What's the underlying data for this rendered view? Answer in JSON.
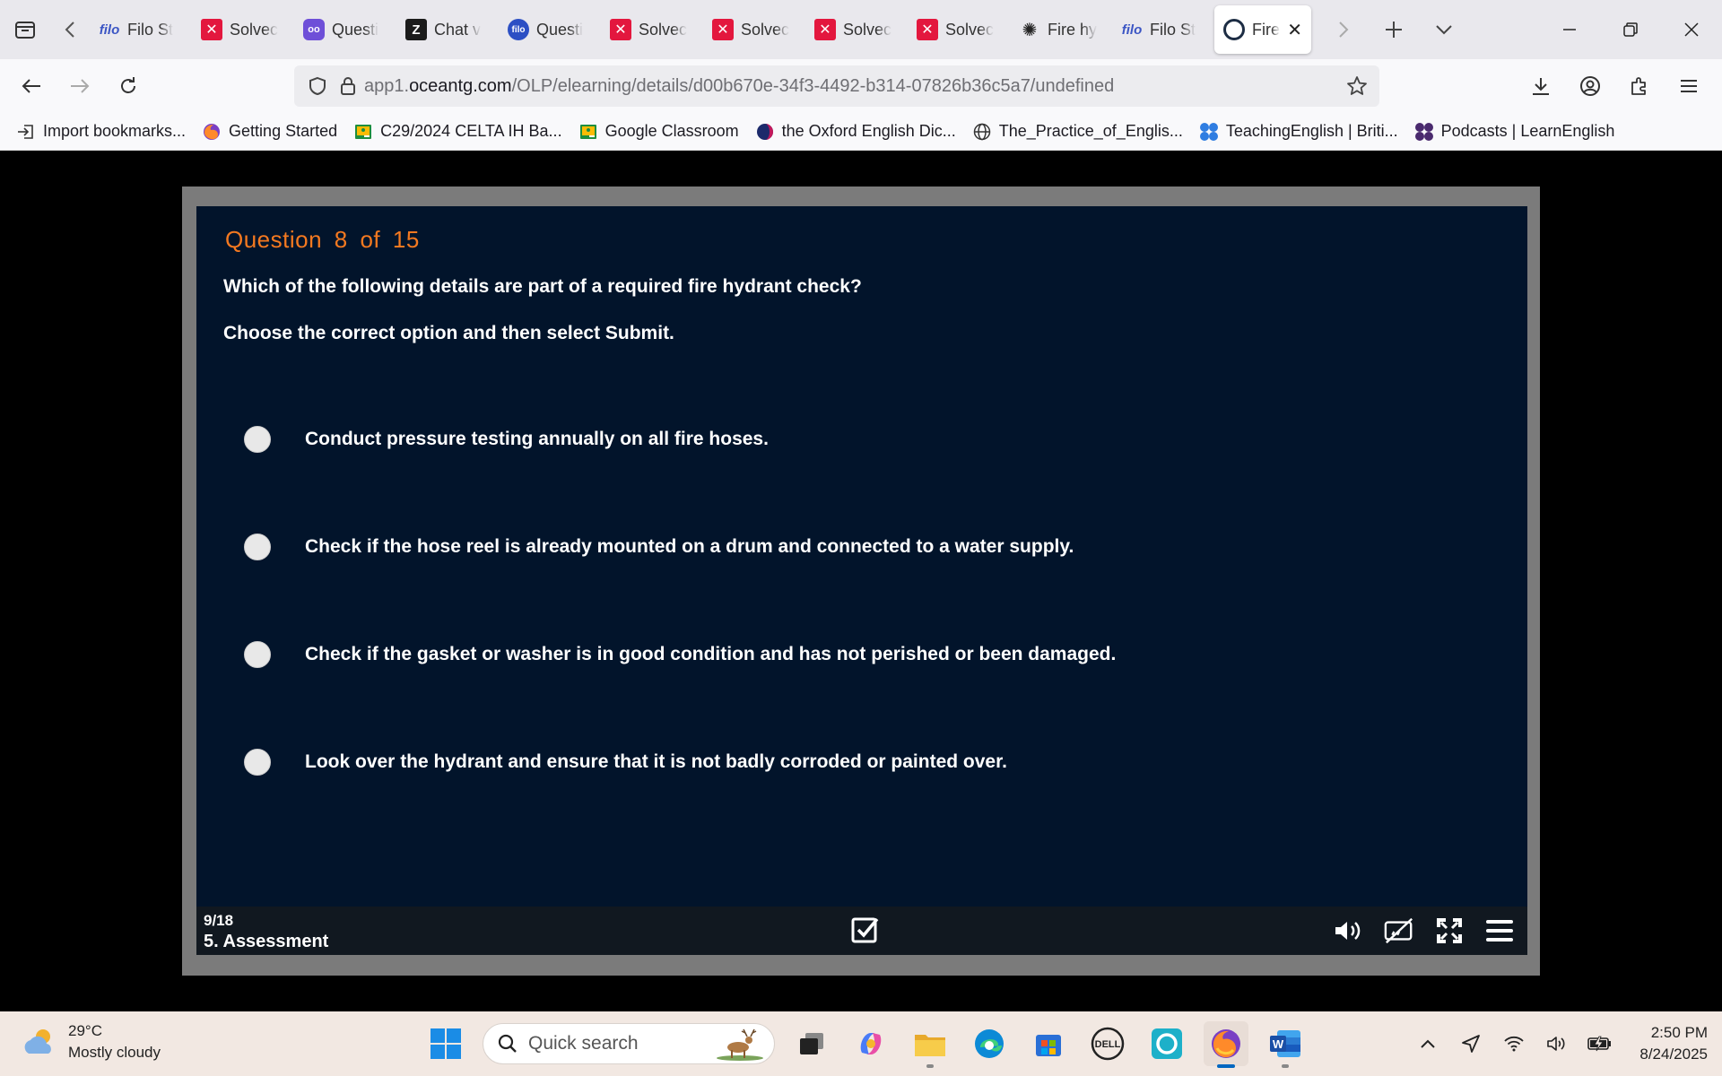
{
  "browser": {
    "tabs": [
      {
        "label": "Filo St",
        "favicon": "filo-icon",
        "favtext": "filo"
      },
      {
        "label": "Solvec",
        "favicon": "solved-x-icon",
        "favtext": "✕"
      },
      {
        "label": "Questi",
        "favicon": "quest-owl-icon",
        "favtext": "oo"
      },
      {
        "label": "Chat v",
        "favicon": "z-icon",
        "favtext": "Z"
      },
      {
        "label": "Questi",
        "favicon": "filo-circle-icon",
        "favtext": "filo"
      },
      {
        "label": "Solvec",
        "favicon": "solved-x-icon",
        "favtext": "✕"
      },
      {
        "label": "Solvec",
        "favicon": "solved-x-icon",
        "favtext": "✕"
      },
      {
        "label": "Solvec",
        "favicon": "solved-x-icon",
        "favtext": "✕"
      },
      {
        "label": "Solvec",
        "favicon": "solved-x-icon",
        "favtext": "✕"
      },
      {
        "label": "Fire hy",
        "favicon": "chatgpt-icon",
        "favtext": "✺"
      },
      {
        "label": "Filo St",
        "favicon": "filo-icon",
        "favtext": "filo"
      }
    ],
    "active_tab": {
      "label": "Fire",
      "favicon": "oceantg-icon"
    },
    "url_prefix": "app1.",
    "url_domain": "oceantg.com",
    "url_path": "/OLP/elearning/details/d00b670e-34f3-4492-b314-07826b36c5a7/undefined",
    "bookmarks": [
      {
        "label": "Import bookmarks...",
        "icon": "import-icon"
      },
      {
        "label": "Getting Started",
        "icon": "firefox-icon"
      },
      {
        "label": "C29/2024 CELTA IH Ba...",
        "icon": "classroom-icon"
      },
      {
        "label": "Google Classroom",
        "icon": "classroom-icon"
      },
      {
        "label": "the Oxford English Dic...",
        "icon": "oxford-icon"
      },
      {
        "label": "The_Practice_of_Englis...",
        "icon": "globe-icon"
      },
      {
        "label": "TeachingEnglish | Briti...",
        "icon": "british-council-icon"
      },
      {
        "label": "Podcasts | LearnEnglish",
        "icon": "british-council-icon"
      }
    ]
  },
  "quiz": {
    "header": "Question  8  of  15",
    "prompt": "Which of the following details are part of a required fire hydrant check?",
    "instruction": "Choose the correct option and then select Submit.",
    "options": [
      "Conduct pressure testing annually on all fire hoses.",
      "Check if the hose reel is already mounted on a drum and connected to a water supply.",
      "Check if the gasket or washer is in good condition and has not perished or been damaged.",
      "Look over the hydrant and ensure that it is not badly corroded or painted over."
    ],
    "slide_count": "9/18",
    "section": "5. Assessment"
  },
  "colors": {
    "slide_bg": "#02142b",
    "header_orange": "#f47920",
    "frame_gray": "#7b7b7b"
  },
  "taskbar": {
    "temperature": "29°C",
    "weather": "Mostly cloudy",
    "search_placeholder": "Quick search",
    "time": "2:50 PM",
    "date": "8/24/2025"
  }
}
